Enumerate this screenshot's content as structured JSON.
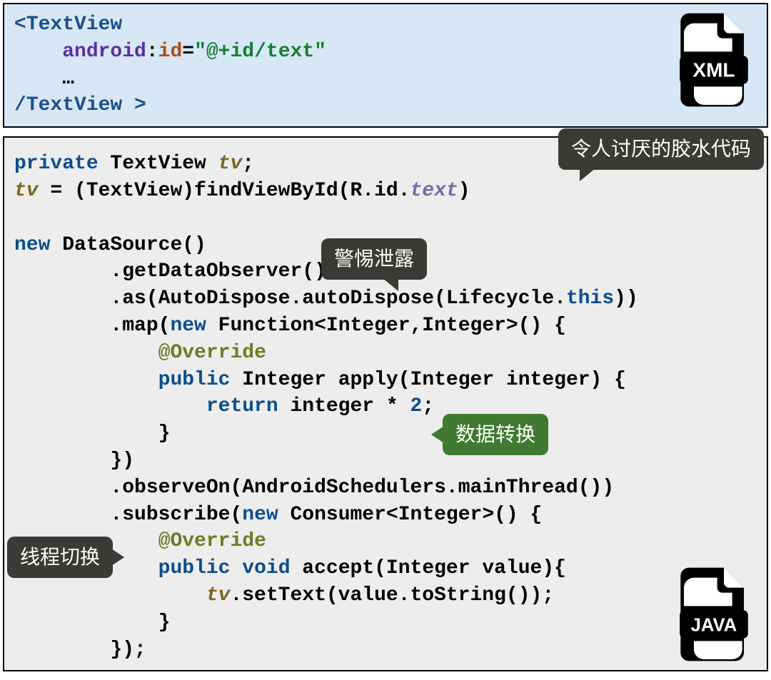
{
  "xml": {
    "open_l": "<",
    "open_tag": "TextView",
    "attr_ns": "android",
    "attr_colon": ":",
    "attr_name": "id",
    "attr_eq": "=",
    "attr_val": "\"@+id/text\"",
    "ellipsis": "    …",
    "close_l": "/",
    "close_tag": "TextView",
    "close_r": " >",
    "icon_label": "XML"
  },
  "java": {
    "l1_kw": "private",
    "l1_type": " TextView ",
    "l1_var": "tv",
    "l2_var": "tv",
    "l2_eq": " = (TextView)findViewById(R.id.",
    "l2_field": "text",
    "l2_end": ")",
    "l4_kw": "new",
    "l4_rest": " DataSource()",
    "l5": "        .getDataObserver()",
    "l6_a": "        .as(AutoDispose.autoDispose(Lifecycle.",
    "l6_kw": "this",
    "l6_b": "))",
    "l7_a": "        .map(",
    "l7_kw": "new",
    "l7_b": " Function<Integer,Integer>() {",
    "l8_ind": "            ",
    "l8_ann": "@Override",
    "l9_ind": "            ",
    "l9_kw": "public",
    "l9_rest": " Integer apply(Integer integer) {",
    "l10_ind": "                ",
    "l10_kw": "return",
    "l10_a": " integer * ",
    "l10_num": "2",
    "l10_b": ";",
    "l11": "            }",
    "l12": "        })",
    "l13": "        .observeOn(AndroidSchedulers.mainThread())",
    "l14_a": "        .subscribe(",
    "l14_kw": "new",
    "l14_b": " Consumer<Integer>() {",
    "l15_ind": "            ",
    "l15_ann": "@Override",
    "l16_ind": "            ",
    "l16_kw1": "public",
    "l16_sp": " ",
    "l16_kw2": "void",
    "l16_rest": " accept(Integer value){",
    "l17_ind": "                ",
    "l17_var": "tv",
    "l17_rest": ".setText(value.toString());",
    "l18": "            }",
    "l19": "        });",
    "icon_label": "JAVA"
  },
  "bubbles": {
    "glue": "令人讨厌的胶水代码",
    "leak": "警惕泄露",
    "transform": "数据转换",
    "thread": "线程切换"
  }
}
